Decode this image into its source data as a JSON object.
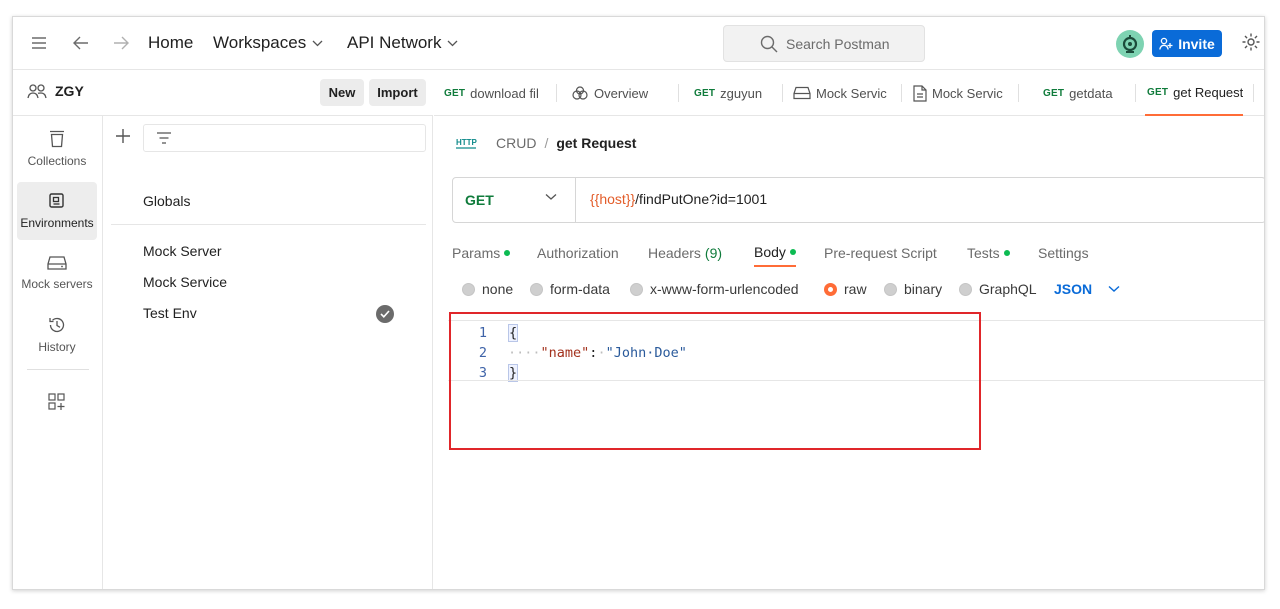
{
  "topbar": {
    "home": "Home",
    "workspaces": "Workspaces",
    "api_network": "API Network",
    "search_placeholder": "Search Postman",
    "invite": "Invite"
  },
  "workspace": {
    "name": "ZGY",
    "new_label": "New",
    "import_label": "Import"
  },
  "rail": [
    {
      "label": "Collections",
      "icon": "collections-icon"
    },
    {
      "label": "Environments",
      "icon": "environments-icon",
      "active": true
    },
    {
      "label": "Mock servers",
      "icon": "mock-servers-icon"
    },
    {
      "label": "History",
      "icon": "history-icon"
    }
  ],
  "environments": {
    "globals": "Globals",
    "items": [
      "Mock Server",
      "Mock Service",
      "Test Env"
    ],
    "active_item": "Test Env"
  },
  "tabs": [
    {
      "method": "GET",
      "label": "download fil"
    },
    {
      "method": "",
      "label": "Overview",
      "icon": "overview-icon"
    },
    {
      "method": "GET",
      "label": "zguyun"
    },
    {
      "method": "",
      "label": "Mock Servic",
      "icon": "mock-server-icon"
    },
    {
      "method": "",
      "label": "Mock Servic",
      "icon": "document-icon"
    },
    {
      "method": "GET",
      "label": "getdata"
    },
    {
      "method": "GET",
      "label": "get Request",
      "active": true
    }
  ],
  "request": {
    "breadcrumb_parent": "CRUD",
    "breadcrumb_sep": "/",
    "breadcrumb_current": "get Request",
    "http_badge": "HTTP",
    "method": "GET",
    "url_var": "{{host}}",
    "url_path": "/findPutOne?id=1001"
  },
  "subtabs": {
    "params": "Params",
    "authorization": "Authorization",
    "headers": "Headers",
    "headers_count": "(9)",
    "body": "Body",
    "prerequest": "Pre-request Script",
    "tests": "Tests",
    "settings": "Settings"
  },
  "body_types": {
    "none": "none",
    "form_data": "form-data",
    "urlencoded": "x-www-form-urlencoded",
    "raw": "raw",
    "binary": "binary",
    "graphql": "GraphQL",
    "format": "JSON",
    "selected": "raw"
  },
  "code": {
    "line1_num": "1",
    "line2_num": "2",
    "line3_num": "3",
    "open_brace": "{",
    "indent": "····",
    "key": "\"name\"",
    "colon": ":",
    "space": "·",
    "value": "\"John·Doe\"",
    "close_brace": "}"
  },
  "colors": {
    "accent": "#ff6c37",
    "invite_bg": "#0a6bd8",
    "get_method": "#0f7b3b",
    "highlight_box": "#e0262a"
  }
}
